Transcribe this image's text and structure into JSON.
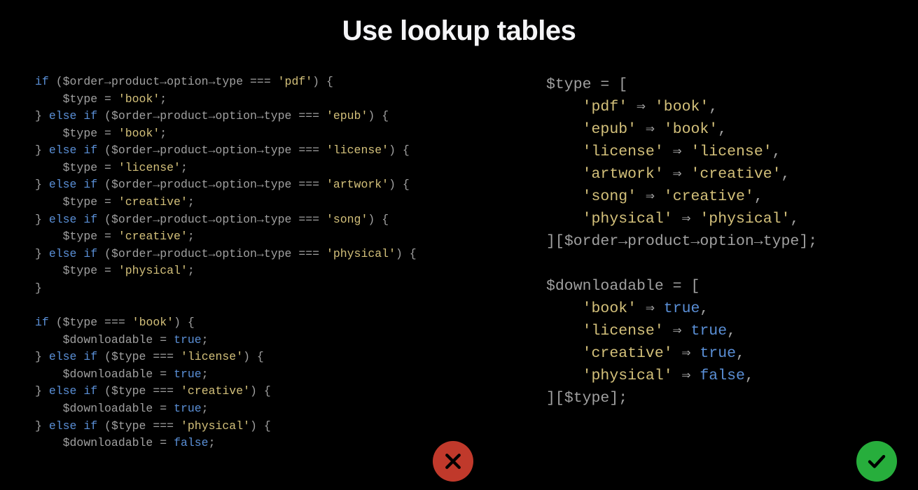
{
  "title": "Use lookup tables",
  "left_code": {
    "block1": [
      {
        "cond_key": "'pdf'",
        "assign_var": "$type",
        "assign_val": "'book'",
        "first": true
      },
      {
        "cond_key": "'epub'",
        "assign_var": "$type",
        "assign_val": "'book'",
        "first": false
      },
      {
        "cond_key": "'license'",
        "assign_var": "$type",
        "assign_val": "'license'",
        "first": false
      },
      {
        "cond_key": "'artwork'",
        "assign_var": "$type",
        "assign_val": "'creative'",
        "first": false
      },
      {
        "cond_key": "'song'",
        "assign_var": "$type",
        "assign_val": "'creative'",
        "first": false
      },
      {
        "cond_key": "'physical'",
        "assign_var": "$type",
        "assign_val": "'physical'",
        "first": false
      }
    ],
    "cond_chain": "$order→product→option→type",
    "block2": [
      {
        "cond_var": "$type",
        "cond_key": "'book'",
        "assign_var": "$downloadable",
        "assign_val": "true",
        "first": true
      },
      {
        "cond_var": "$type",
        "cond_key": "'license'",
        "assign_var": "$downloadable",
        "assign_val": "true",
        "first": false
      },
      {
        "cond_var": "$type",
        "cond_key": "'creative'",
        "assign_var": "$downloadable",
        "assign_val": "true",
        "first": false
      },
      {
        "cond_var": "$type",
        "cond_key": "'physical'",
        "assign_var": "$downloadable",
        "assign_val": "false",
        "first": false
      }
    ]
  },
  "right_code": {
    "lookup1": {
      "var": "$type",
      "entries": [
        {
          "k": "'pdf'",
          "v": "'book'"
        },
        {
          "k": "'epub'",
          "v": "'book'"
        },
        {
          "k": "'license'",
          "v": "'license'"
        },
        {
          "k": "'artwork'",
          "v": "'creative'"
        },
        {
          "k": "'song'",
          "v": "'creative'"
        },
        {
          "k": "'physical'",
          "v": "'physical'"
        }
      ],
      "index_chain": "$order→product→option→type"
    },
    "lookup2": {
      "var": "$downloadable",
      "entries": [
        {
          "k": "'book'",
          "v": "true"
        },
        {
          "k": "'license'",
          "v": "true"
        },
        {
          "k": "'creative'",
          "v": "true"
        },
        {
          "k": "'physical'",
          "v": "false"
        }
      ],
      "index_var": "$type"
    }
  },
  "badges": {
    "bad": "cross-icon",
    "good": "check-icon"
  }
}
